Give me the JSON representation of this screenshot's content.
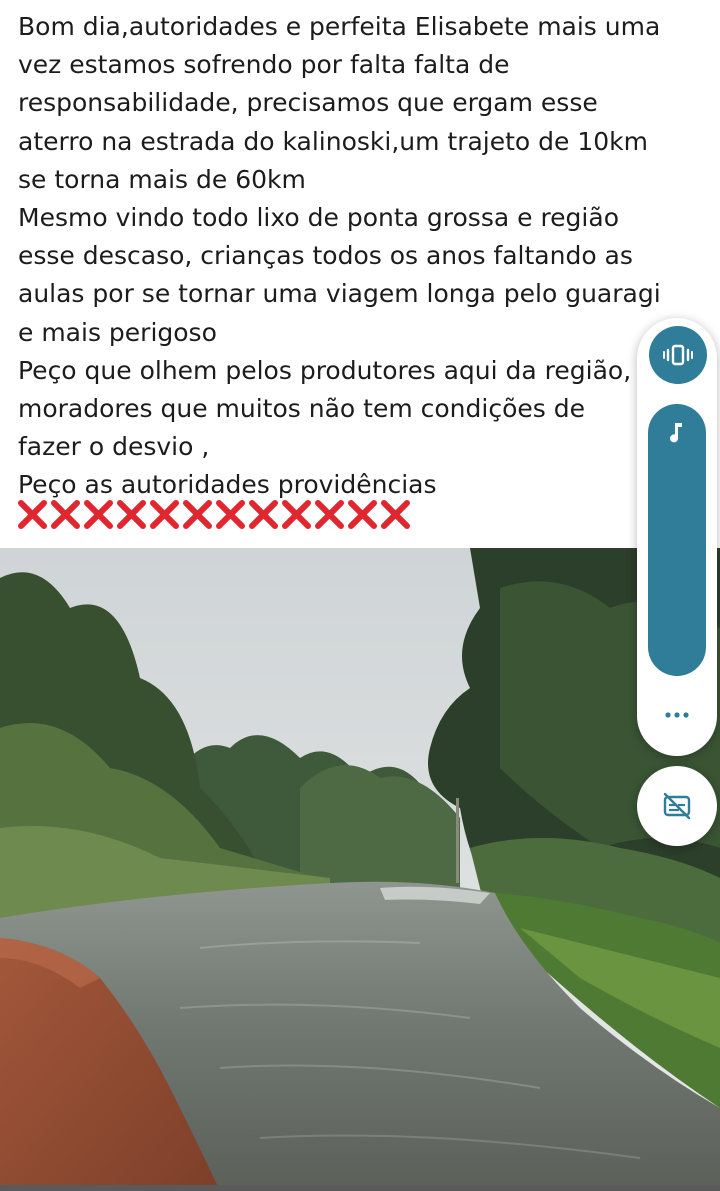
{
  "post": {
    "lines": [
      "Bom dia,autoridades e perfeita Elisabete mais uma",
      "vez estamos sofrendo por falta falta de",
      "responsabilidade, precisamos que ergam esse",
      "aterro na estrada do kalinoski,um trajeto de 10km",
      "se torna mais de 60km",
      "Mesmo vindo todo lixo de ponta grossa e região",
      "esse descaso, crianças todos os anos faltando as",
      "aulas por se tornar uma viagem longa pelo guaragi",
      "e mais perigoso",
      "Peço que olhem pelos produtores aqui da região,",
      "moradores que muitos não tem condições de",
      "fazer o desvio ,",
      "Peço as autoridades providências"
    ],
    "cross_mark_count": 12,
    "cross_mark_color": "#e0262e"
  },
  "photo": {
    "subject": "flooded-dirt-road-with-trees"
  },
  "volume_panel": {
    "vibrate_icon": "vibrate-icon",
    "media_icon": "music-note-icon",
    "more_icon": "more-dots-icon",
    "caption_icon": "captions-off-icon",
    "accent_color": "#2f7d98"
  }
}
